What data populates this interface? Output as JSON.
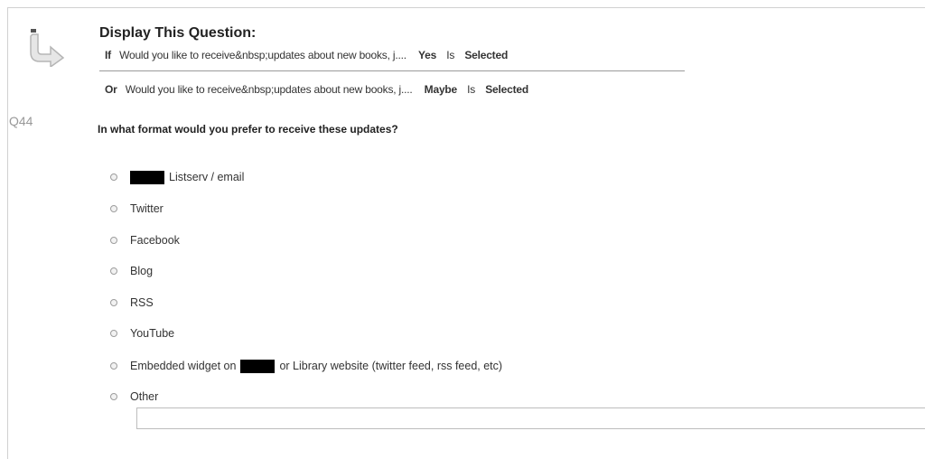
{
  "display_logic": {
    "title": "Display This Question:",
    "conditions": [
      {
        "keyword": "If",
        "question": "Would you like to receive&nbsp;updates about new books, j....",
        "value": "Yes",
        "operator": "Is",
        "state": "Selected"
      },
      {
        "keyword": "Or",
        "question": "Would you like to receive&nbsp;updates about new books, j....",
        "value": "Maybe",
        "operator": "Is",
        "state": "Selected"
      }
    ]
  },
  "question": {
    "number": "Q44",
    "text": "In what format would you prefer to receive these updates?",
    "choices": [
      {
        "pre": "",
        "post": "Listserv / email"
      },
      {
        "pre": "Twitter",
        "post": ""
      },
      {
        "pre": "Facebook",
        "post": ""
      },
      {
        "pre": "Blog",
        "post": ""
      },
      {
        "pre": "RSS",
        "post": ""
      },
      {
        "pre": "YouTube",
        "post": ""
      },
      {
        "pre": "Embedded widget on",
        "post": "or Library website (twitter feed, rss feed, etc)"
      },
      {
        "pre": "Other",
        "post": ""
      }
    ]
  },
  "icons": {
    "logic": "display-logic-arrow-icon",
    "choice": "radio-button"
  }
}
